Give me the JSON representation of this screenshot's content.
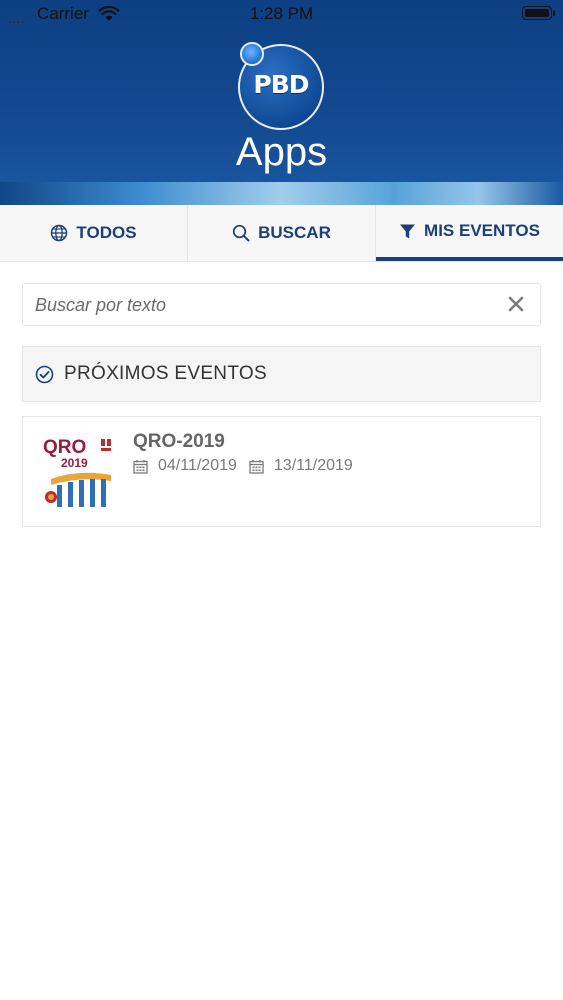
{
  "status_bar": {
    "carrier": "Carrier",
    "time": "1:28 PM"
  },
  "header": {
    "logo_text": "PBD",
    "app_name": "Apps"
  },
  "tabs": [
    {
      "label": "TODOS",
      "icon": "globe-icon",
      "active": false
    },
    {
      "label": "BUSCAR",
      "icon": "search-icon",
      "active": false
    },
    {
      "label": "MIS EVENTOS",
      "icon": "filter-icon",
      "active": true
    }
  ],
  "search": {
    "placeholder": "Buscar por texto",
    "value": ""
  },
  "section": {
    "label": "PRÓXIMOS EVENTOS",
    "icon": "check-circle-icon"
  },
  "events": [
    {
      "title": "QRO-2019",
      "start_date": "04/11/2019",
      "end_date": "13/11/2019",
      "thumbnail_text": "QRO",
      "thumbnail_year": "2019"
    }
  ],
  "colors": {
    "brand_blue": "#0d3f82",
    "tab_text": "#1b3f7a",
    "thumb_red": "#9b1b3a"
  }
}
